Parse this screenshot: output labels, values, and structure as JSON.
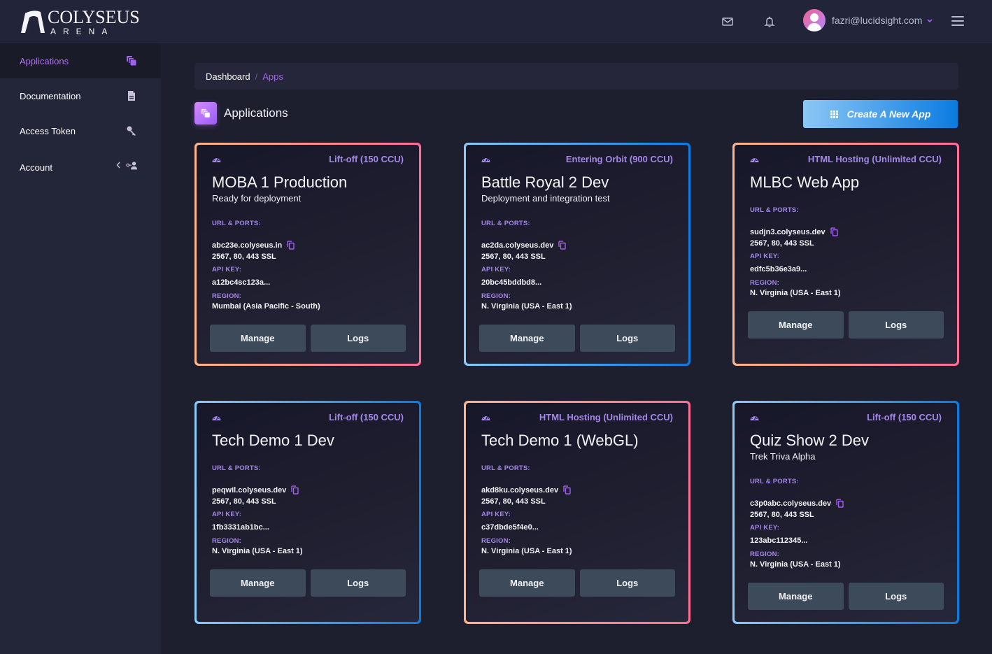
{
  "brand": {
    "title": "COLYSEUS",
    "subtitle": "ARENA"
  },
  "topbar": {
    "user_email": "fazri@lucidsight.com"
  },
  "sidebar": {
    "items": [
      {
        "label": "Applications",
        "icon": "applications-icon",
        "active": true
      },
      {
        "label": "Documentation",
        "icon": "document-icon"
      },
      {
        "label": "Access Token",
        "icon": "key-icon"
      },
      {
        "label": "Account",
        "icon": "user-key-icon"
      }
    ]
  },
  "breadcrumb": {
    "home": "Dashboard",
    "separator": "/",
    "current": "Apps"
  },
  "page": {
    "title": "Applications",
    "create_button": "Create A New App"
  },
  "labels": {
    "url_ports": "URL & PORTS:",
    "api_key": "API KEY:",
    "region": "REGION:",
    "manage": "Manage",
    "logs": "Logs"
  },
  "colors": {
    "accent": "#a35ef5",
    "warm_border_start": "#ffb58a",
    "warm_border_end": "#ff6e94",
    "cool_border_start": "#8ccaf8",
    "cool_border_end": "#0a7be0",
    "button": "#3d4a5a"
  },
  "apps": [
    {
      "plan": "Lift-off (150 CCU)",
      "name": "MOBA 1 Production",
      "description": "Ready for deployment",
      "url": "abc23e.colyseus.in",
      "ports": "2567, 80, 443 SSL",
      "api_key": "a12bc4sc123a...",
      "region": "Mumbai (Asia Pacific - South)",
      "theme": "warm"
    },
    {
      "plan": "Entering Orbit (900 CCU)",
      "name": "Battle Royal 2 Dev",
      "description": "Deployment and integration test",
      "url": "ac2da.colyseus.dev",
      "ports": "2567, 80, 443 SSL",
      "api_key": "20bc45bddbd8...",
      "region": "N. Virginia (USA - East 1)",
      "theme": "cool"
    },
    {
      "plan": "HTML Hosting (Unlimited CCU)",
      "name": "MLBC Web App",
      "description": "",
      "url": "sudjn3.colyseus.dev",
      "ports": "2567, 80, 443 SSL",
      "api_key": "edfc5b36e3a9...",
      "region": "N. Virginia (USA - East 1)",
      "theme": "warm"
    },
    {
      "plan": "Lift-off (150 CCU)",
      "name": "Tech Demo 1 Dev",
      "description": "",
      "url": "peqwil.colyseus.dev",
      "ports": "2567, 80, 443 SSL",
      "api_key": "1fb3331ab1bc...",
      "region": "N. Virginia (USA - East 1)",
      "theme": "cool"
    },
    {
      "plan": "HTML Hosting (Unlimited CCU)",
      "name": "Tech Demo 1 (WebGL)",
      "description": "",
      "url": "akd8ku.colyseus.dev",
      "ports": "2567, 80, 443 SSL",
      "api_key": "c37dbde5f4e0...",
      "region": "N. Virginia (USA - East 1)",
      "theme": "warm"
    },
    {
      "plan": "Lift-off (150 CCU)",
      "name": "Quiz Show 2 Dev",
      "description": "Trek Triva Alpha",
      "url": "c3p0abc.colyseus.dev",
      "ports": "2567, 80, 443 SSL",
      "api_key": "123abc112345...",
      "region": "N. Virginia (USA - East 1)",
      "theme": "cool"
    }
  ]
}
